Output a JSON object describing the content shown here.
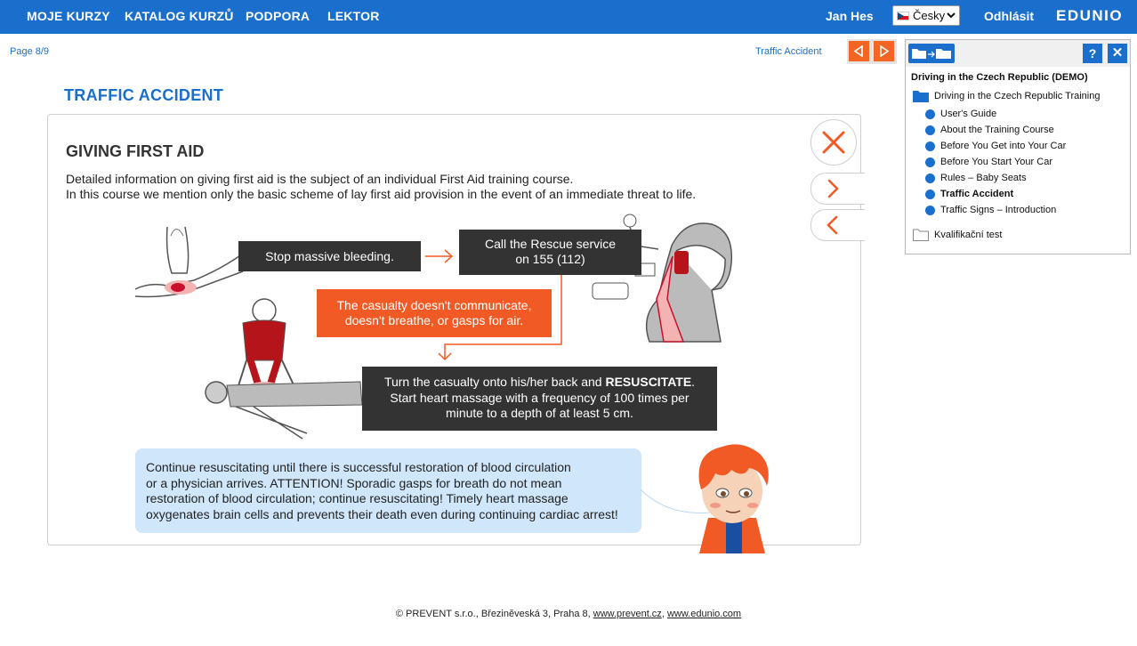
{
  "nav": {
    "items": [
      "MOJE KURZY",
      "KATALOG KURZŮ",
      "PODPORA",
      "LEKTOR"
    ],
    "user": "Jan Hes",
    "language": "Česky",
    "logout": "Odhlásit",
    "logo": "EDUNIO"
  },
  "page": {
    "info": "Page 8/9",
    "breadcrumb": "Traffic Accident",
    "title": "TRAFFIC ACCIDENT"
  },
  "content": {
    "heading": "GIVING FIRST AID",
    "intro_line1": "Detailed information on giving first aid is the subject of an individual First Aid training course.",
    "intro_line2": "In this course we mention only the basic scheme of lay first aid provision in the event of an immediate threat to life.",
    "step_bleeding": "Stop massive bleeding.",
    "step_rescue_line1": "Call the Rescue service",
    "step_rescue_line2": "on 155 (112)",
    "step_casualty_line1": "The casualty doesn't communicate,",
    "step_casualty_line2": "doesn't breathe, or gasps for air.",
    "step_resus_line1a": "Turn the casualty onto his/her back and ",
    "step_resus_line1b": "RESUSCITATE",
    "step_resus_line1c": ".",
    "step_resus_line2": "Start heart massage with a frequency of 100 times per",
    "step_resus_line3": "minute to a depth of at least 5 cm.",
    "note_line1": "Continue resuscitating until there is successful restoration of blood circulation",
    "note_line2": "or a physician arrives. ATTENTION! Sporadic gasps for breath do not mean",
    "note_line3": "restoration of blood circulation; continue resuscitating! Timely heart massage",
    "note_line4": "oxygenates brain cells and prevents their death even during continuing cardiac arrest!"
  },
  "footer": {
    "text": "© PREVENT s.r.o., Březinĕveská 3, Praha 8, ",
    "link1": "www.prevent.cz",
    "sep": ", ",
    "link2": "www.edunio.com"
  },
  "panel": {
    "help": "?",
    "close": "✕",
    "course_title": "Driving in the Czech Republic (DEMO)",
    "folder": "Driving in the Czech Republic Training",
    "items": [
      "User's Guide",
      "About the Training Course",
      "Before You Get into Your Car",
      "Before You Start Your Car",
      "Rules – Baby Seats",
      "Traffic Accident",
      "Traffic Signs – Introduction"
    ],
    "test": "Kvalifikační test"
  },
  "colors": {
    "brand_blue": "#1a6fcc",
    "accent_orange": "#f15a24",
    "dark_box": "#333333",
    "note_blue": "#cfe6fb"
  }
}
